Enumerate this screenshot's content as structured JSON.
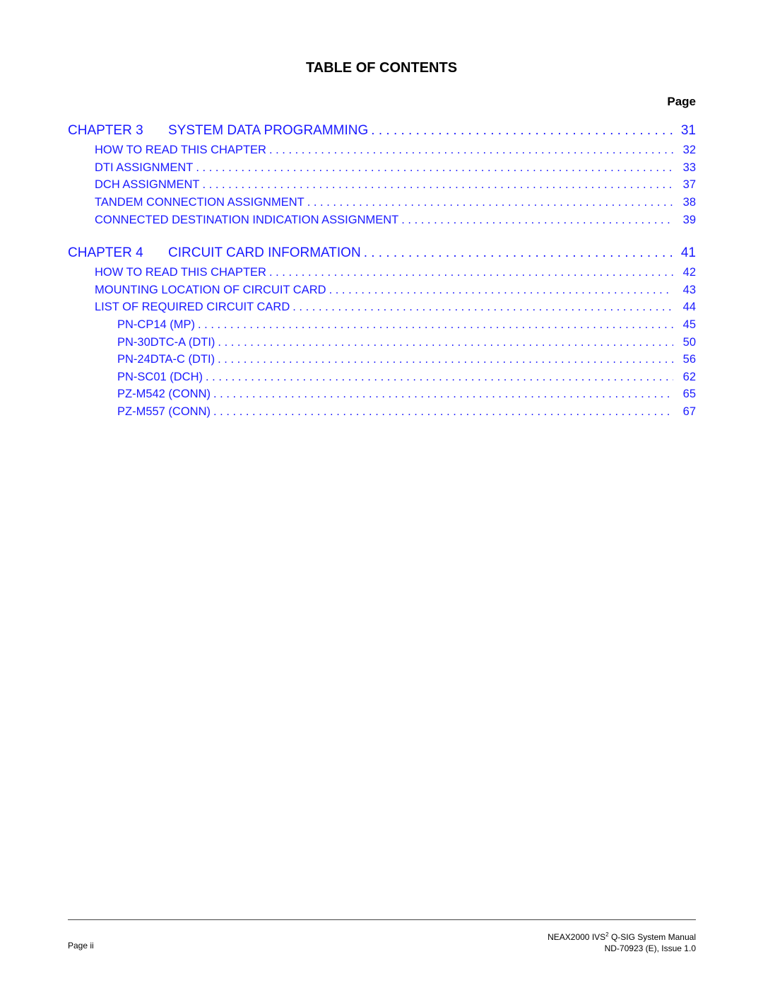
{
  "title": "TABLE OF CONTENTS",
  "page_column_header": "Page",
  "chapters": [
    {
      "number": "CHAPTER 3",
      "title": "SYSTEM DATA PROGRAMMING",
      "page": "31",
      "sections": [
        {
          "title": "HOW TO READ THIS CHAPTER",
          "page": "32"
        },
        {
          "title": "DTI ASSIGNMENT",
          "page": "33"
        },
        {
          "title": "DCH ASSIGNMENT",
          "page": "37"
        },
        {
          "title": "TANDEM CONNECTION ASSIGNMENT",
          "page": "38"
        },
        {
          "title": "CONNECTED DESTINATION INDICATION ASSIGNMENT",
          "page": "39"
        }
      ]
    },
    {
      "number": "CHAPTER 4",
      "title": "CIRCUIT CARD INFORMATION",
      "page": "41",
      "sections": [
        {
          "title": "HOW TO READ THIS CHAPTER",
          "page": "42"
        },
        {
          "title": "MOUNTING LOCATION OF CIRCUIT CARD",
          "page": "43"
        },
        {
          "title": "LIST OF REQUIRED CIRCUIT CARD",
          "page": "44"
        }
      ],
      "subsections": [
        {
          "title": "PN-CP14 (MP)",
          "page": "45"
        },
        {
          "title": "PN-30DTC-A (DTI)",
          "page": "50"
        },
        {
          "title": "PN-24DTA-C (DTI)",
          "page": "56"
        },
        {
          "title": "PN-SC01 (DCH)",
          "page": "62"
        },
        {
          "title": "PZ-M542 (CONN)",
          "page": "65"
        },
        {
          "title": "PZ-M557 (CONN)",
          "page": "67"
        }
      ]
    }
  ],
  "footer": {
    "page_label": "Page ii",
    "manual_title_prefix": "NEAX2000 IVS",
    "manual_title_sup": "2",
    "manual_title_suffix": " Q-SIG System Manual",
    "doc_id": "ND-70923 (E), Issue 1.0"
  },
  "colors": {
    "link": "#1a1aff",
    "text": "#000000"
  }
}
